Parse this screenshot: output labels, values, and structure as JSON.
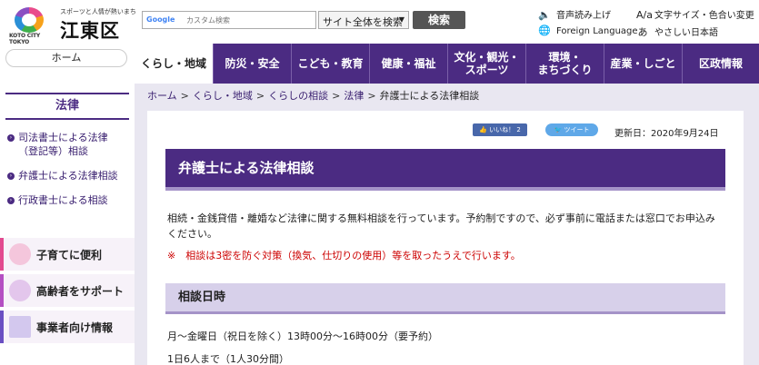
{
  "header": {
    "logo_tagline": "スポーツと人情が熱いまち",
    "logo_name": "江東区",
    "logo_sub": "KOTO CITY TOKYO",
    "search_google": "Google",
    "search_placeholder": "カスタム検索",
    "scope_selected": "サイト全体を検索",
    "search_button": "検索",
    "utils": {
      "read_aloud": "音声読み上げ",
      "text_size": "文字サイズ・色合い変更",
      "foreign": "Foreign Language",
      "easy_japanese": "やさしい日本語"
    }
  },
  "nav": [
    {
      "label": "くらし・地域",
      "active": true
    },
    {
      "label": "防災・安全"
    },
    {
      "label": "こども・教育"
    },
    {
      "label": "健康・福祉"
    },
    {
      "label": "文化・観光・スポーツ",
      "line1": "文化・観光・",
      "line2": "スポーツ"
    },
    {
      "label": "環境・まちづくり",
      "line1": "環境・",
      "line2": "まちづくり"
    },
    {
      "label": "産業・しごと"
    },
    {
      "label": "区政情報"
    }
  ],
  "sidebar": {
    "home": "ホーム",
    "category": "法律",
    "links": [
      "司法書士による法律（登記等）相談",
      "弁護士による法律相談",
      "行政書士による相談"
    ],
    "banners": [
      {
        "label": "子育てに便利",
        "color": "#e24a8f"
      },
      {
        "label": "高齢者をサポート",
        "color": "#b44fc2"
      },
      {
        "label": "事業者向け情報",
        "color": "#6a4fc2"
      }
    ]
  },
  "breadcrumb": [
    "ホーム",
    "くらし・地域",
    "くらしの相談",
    "法律",
    "弁護士による法律相談"
  ],
  "main": {
    "like": "いいね！ 2",
    "tweet": "ツイート",
    "updated": "更新日：2020年9月24日",
    "title": "弁護士による法律相談",
    "description": "相続・金銭貸借・離婚など法律に関する無料相談を行っています。予約制ですので、必ず事前に電話または窓口でお申込みください。",
    "notice": "※　相談は3密を防ぐ対策（換気、仕切りの使用）等を取ったうえで行います。",
    "section_title": "相談日時",
    "schedule": "月～金曜日（祝日を除く）13時00分～16時00分（要予約）",
    "capacity": "1日6人まで（1人30分間）"
  }
}
